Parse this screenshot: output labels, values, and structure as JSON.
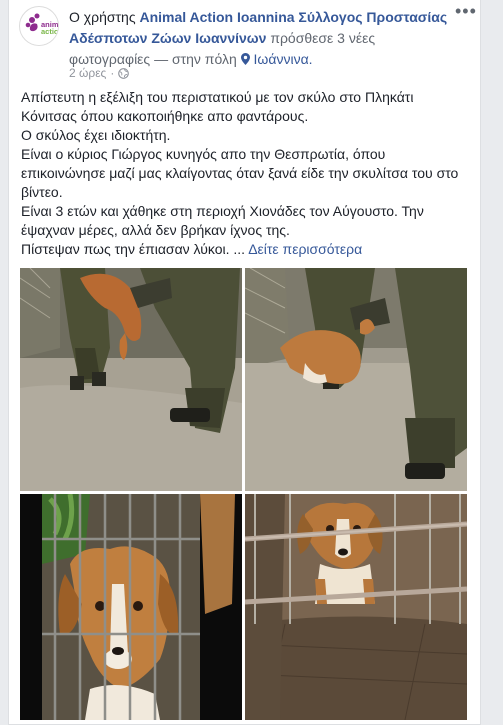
{
  "post": {
    "prefix": "Ο χρήστης",
    "page_name": "Animal Action Ioannina Σύλλογος Προστασίας Αδέσποτων Ζώων Ιωαννίνων",
    "action_text": "πρόσθεσε 3 νέες",
    "photos_link": "φωτογραφίες",
    "location_prefix": "— στην πόλη",
    "location": "Ιωάννινα.",
    "timestamp": "2 ώρες",
    "privacy_icon": "globe-icon",
    "more_icon": "more-options-icon"
  },
  "avatar": {
    "logo_text_1": "animal",
    "logo_text_2": "action"
  },
  "body": {
    "lines": [
      "Απίστευτη η εξέλιξη του περιστατικού με τον σκύλο στο Πληκάτι Κόνιτσας όπου κακοποιήθηκε απο φαντάρους.",
      "Ο σκύλος έχει ιδιοκτήτη.",
      "Είναι ο κύριος Γιώργος κυνηγός απο την Θεσπρωτία, όπου επικοινώνησε μαζί μας κλαίγοντας όταν ξανά είδε την σκυλίτσα του στο βίντεο.",
      "Είναι 3 ετών και χάθηκε στη περιοχή Χιονάδες τον Αύγουστο. Την έψαχναν μέρες, αλλά δεν βρήκαν ίχνος της."
    ],
    "last_line": "Πίστεψαν πως την έπιασαν λύκοι.",
    "ellipsis": "...",
    "see_more": "Δείτε περισσότερα"
  },
  "colors": {
    "link": "#365899",
    "text": "#1d2129",
    "meta": "#90949c",
    "logo_purple": "#8e2c8e",
    "logo_green": "#7ab648"
  }
}
